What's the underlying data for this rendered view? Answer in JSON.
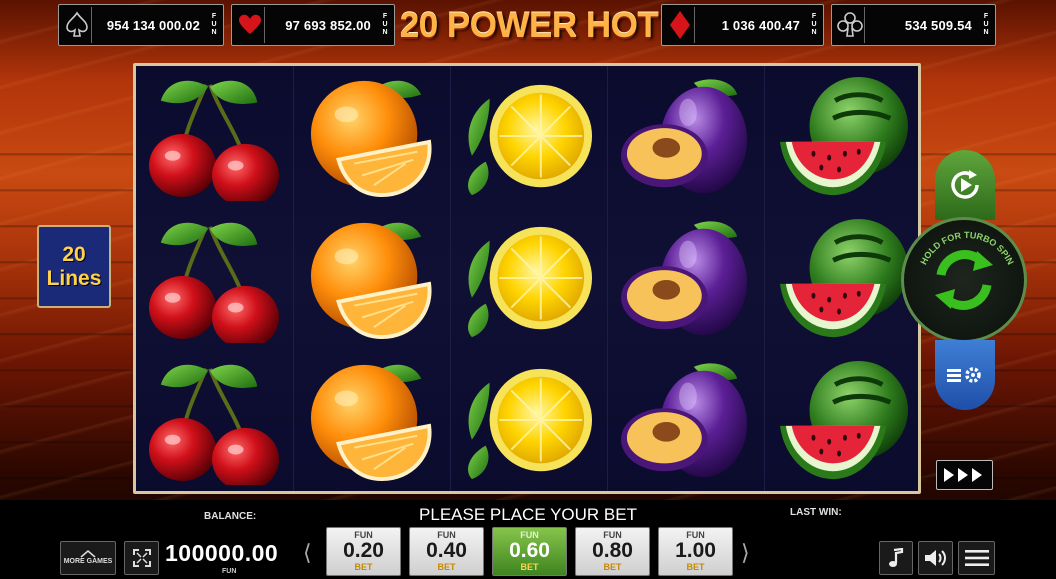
{
  "game": {
    "title": "20 POWER HOT"
  },
  "jackpots": [
    {
      "suit": "spade",
      "value": "954 134 000.02",
      "currency": "FUN"
    },
    {
      "suit": "heart",
      "value": "97 693 852.00",
      "currency": "FUN"
    },
    {
      "suit": "diamond",
      "value": "1 036 400.47",
      "currency": "FUN"
    },
    {
      "suit": "club",
      "value": "534 509.54",
      "currency": "FUN"
    }
  ],
  "lines": {
    "count": "20",
    "label": "Lines"
  },
  "reels": [
    [
      "cherry",
      "cherry",
      "cherry"
    ],
    [
      "orange",
      "orange",
      "orange"
    ],
    [
      "lemon",
      "lemon",
      "lemon"
    ],
    [
      "plum",
      "plum",
      "plum"
    ],
    [
      "watermelon",
      "watermelon",
      "watermelon"
    ]
  ],
  "controls": {
    "turbo_hint": "HOLD FOR TURBO SPIN",
    "autoplay_icon": "autoplay-icon",
    "spin_icon": "spin-arrows-icon",
    "settings_icon": "settings-icon",
    "skip_icon": "fast-forward-icon"
  },
  "bottom": {
    "balance_label": "BALANCE:",
    "balance_value": "100000.00",
    "balance_currency": "FUN",
    "status_message": "PLEASE PLACE YOUR BET",
    "last_win_label": "LAST WIN:",
    "more_games_label": "MORE GAMES",
    "bets": [
      {
        "top": "FUN",
        "value": "0.20",
        "bottom": "BET",
        "selected": false
      },
      {
        "top": "FUN",
        "value": "0.40",
        "bottom": "BET",
        "selected": false
      },
      {
        "top": "FUN",
        "value": "0.60",
        "bottom": "BET",
        "selected": true
      },
      {
        "top": "FUN",
        "value": "0.80",
        "bottom": "BET",
        "selected": false
      },
      {
        "top": "FUN",
        "value": "1.00",
        "bottom": "BET",
        "selected": false
      }
    ],
    "arrow_left": "⟨",
    "arrow_right": "⟩"
  },
  "colors": {
    "accent_green": "#3e8420",
    "bet_gold": "#c68a00",
    "reel_bg": "#0b0b2e"
  }
}
